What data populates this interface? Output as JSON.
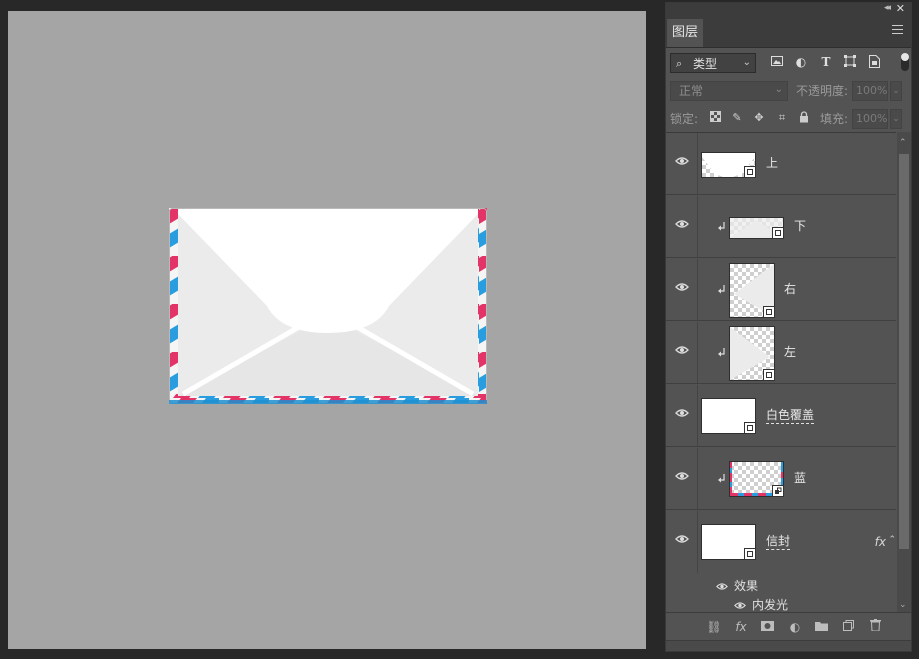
{
  "panel": {
    "tab_label": "图层",
    "filter": {
      "kind_label": "类型",
      "kind_icons": [
        "image-filter-icon",
        "adjustment-filter-icon",
        "type-filter-icon",
        "shape-filter-icon",
        "smartobject-filter-icon"
      ]
    },
    "blend": {
      "mode": "正常",
      "opacity_label": "不透明度:",
      "opacity_value": "100%"
    },
    "lock": {
      "lock_label": "锁定:",
      "fill_label": "填充:",
      "fill_value": "100%"
    }
  },
  "layers": [
    {
      "name": "上",
      "clipped": false,
      "thumb": "top-flap"
    },
    {
      "name": "下",
      "clipped": true,
      "thumb": "bottom-flap"
    },
    {
      "name": "右",
      "clipped": true,
      "thumb": "right-flap"
    },
    {
      "name": "左",
      "clipped": true,
      "thumb": "left-flap"
    },
    {
      "name": "白色覆盖",
      "clipped": false,
      "thumb": "white"
    },
    {
      "name": "蓝",
      "clipped": true,
      "thumb": "stripes"
    },
    {
      "name": "信封",
      "clipped": false,
      "thumb": "white",
      "fx": "fx"
    }
  ],
  "effects": {
    "label": "效果",
    "items": [
      "内发光"
    ]
  },
  "colors": {
    "canvas_bg": "#a5a5a5",
    "stripe_red": "#e23466",
    "stripe_blue": "#2a9de0",
    "panel_bg": "#535353"
  }
}
